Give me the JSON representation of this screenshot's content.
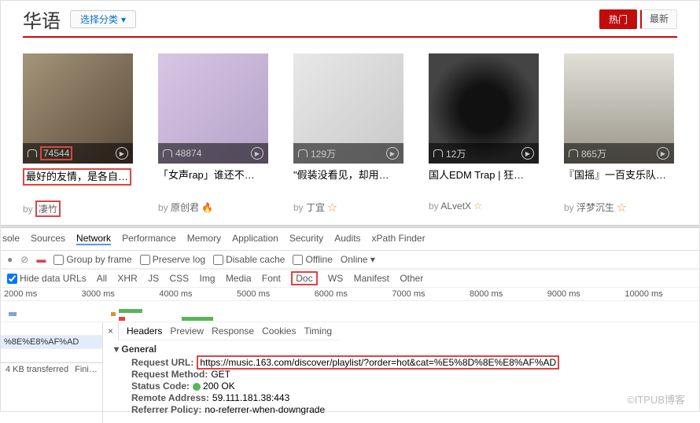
{
  "header": {
    "title": "华语",
    "select": "选择分类",
    "hot": "热门",
    "new": "最新"
  },
  "grid": [
    {
      "plays": "74544",
      "title": "最好的友情，是各自…",
      "by": "凄竹",
      "auth": "",
      "hl": true
    },
    {
      "plays": "48874",
      "title": "「女声rap」谁还不…",
      "by": "原创君",
      "auth": "flame"
    },
    {
      "plays": "129万",
      "title": "\"假装没看见，却用…",
      "by": "丁宜",
      "auth": "star"
    },
    {
      "plays": "12万",
      "title": "国人EDM Trap | 狂…",
      "by": "ALvetX",
      "auth": "star"
    },
    {
      "plays": "865万",
      "title": "『国摇』一百支乐队…",
      "by": "浮梦沉生",
      "auth": "star"
    }
  ],
  "dev": {
    "tabs": [
      "sole",
      "Sources",
      "Network",
      "Performance",
      "Memory",
      "Application",
      "Security",
      "Audits",
      "xPath Finder"
    ],
    "active": "Network",
    "tb": {
      "group": "Group by frame",
      "preserve": "Preserve log",
      "disable": "Disable cache",
      "offline": "Offline",
      "online": "Online"
    },
    "sub": {
      "hide": "Hide data URLs",
      "filters": [
        "All",
        "XHR",
        "JS",
        "CSS",
        "Img",
        "Media",
        "Font",
        "Doc",
        "WS",
        "Manifest",
        "Other"
      ],
      "active": "Doc"
    },
    "ticks": [
      "2000 ms",
      "3000 ms",
      "4000 ms",
      "5000 ms",
      "6000 ms",
      "7000 ms",
      "8000 ms",
      "9000 ms",
      "10000 ms"
    ],
    "reqRow": "%8E%E8%AF%AD",
    "rtabs": [
      "Headers",
      "Preview",
      "Response",
      "Cookies",
      "Timing"
    ],
    "general": {
      "title": "General",
      "url_l": "Request URL:",
      "url": "https://music.163.com/discover/playlist/?order=hot&cat=%E5%8D%8E%E8%AF%AD",
      "method_l": "Request Method:",
      "method": "GET",
      "status_l": "Status Code:",
      "status": "200 OK",
      "addr_l": "Remote Address:",
      "addr": "59.111.181.38:443",
      "ref_l": "Referrer Policy:",
      "ref": "no-referrer-when-downgrade"
    },
    "status": [
      "4 KB transferred",
      "Fini…"
    ]
  },
  "watermark": "©ITPUB博客",
  "chart_data": {
    "type": "timeline",
    "x_ticks_ms": [
      2000,
      3000,
      4000,
      5000,
      6000,
      7000,
      8000,
      9000,
      10000
    ],
    "note": "waterfall bars positions are illustrative"
  }
}
